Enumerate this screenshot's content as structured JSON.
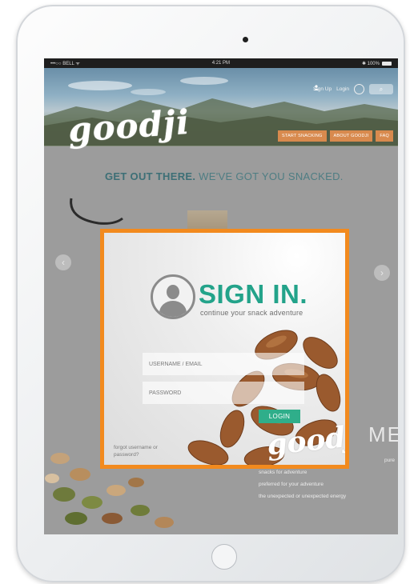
{
  "status_bar": {
    "carrier": "•••○○ BELL ᯤ",
    "time": "4:21 PM",
    "battery": "✱ 100%"
  },
  "header": {
    "sign_up": "Sign Up",
    "login": "Login",
    "nav": [
      "START SNACKING",
      "ABOUT GOODJI",
      "FAQ"
    ]
  },
  "brand": {
    "logo": "goodji"
  },
  "tagline": {
    "bold": "GET OUT THERE.",
    "rest": " WE'VE GOT YOU SNACKED."
  },
  "page": {
    "heading_partial": "ME",
    "text_lines": [
      "pure",
      "snacks for adventure",
      "preferred for your adventure",
      "the unexpected or unexpected energy"
    ]
  },
  "modal": {
    "title": "SIGN IN.",
    "subtitle": "continue your snack adventure",
    "username_placeholder": "USERNAME / EMAIL",
    "password_placeholder": "PASSWORD",
    "login_label": "LOGIN",
    "forgot": "forgot username or password?",
    "logo": "goodji"
  },
  "colors": {
    "accent_orange": "#f28a1e",
    "teal": "#23a38a",
    "login_button": "#2fae8a",
    "nav_button": "#d88a4e"
  },
  "icons": [
    "user-icon",
    "search-icon",
    "chevron-left-icon",
    "chevron-right-icon",
    "avatar-icon"
  ]
}
